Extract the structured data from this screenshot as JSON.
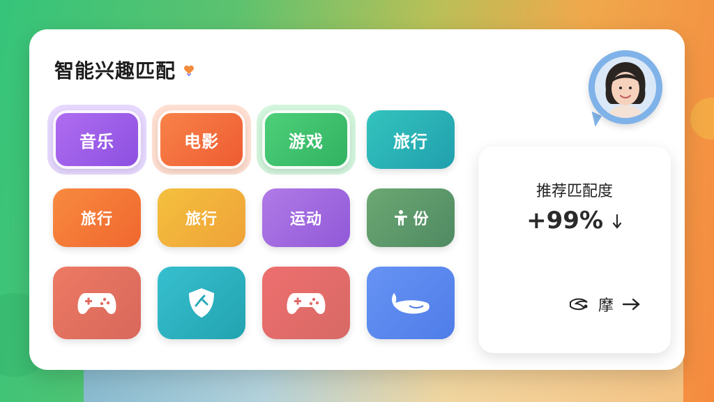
{
  "header": {
    "title": "智能兴趣匹配"
  },
  "tiles": [
    {
      "label": "音乐",
      "color": "#9b5de5",
      "selected": true
    },
    {
      "label": "电影",
      "color": "#f3693d",
      "selected": true
    },
    {
      "label": "游戏",
      "color": "#3cc46a",
      "selected": true
    },
    {
      "label": "旅行",
      "color": "#2fb9b6",
      "selected": false
    },
    {
      "label": "旅行",
      "color": "#f47a35",
      "selected": false
    },
    {
      "label": "旅行",
      "color": "#f0b43a",
      "selected": false
    },
    {
      "label": "运动",
      "color": "#a169e0",
      "selected": false
    },
    {
      "label": "份",
      "color": "#5f9a6a",
      "icon": "fitness-icon",
      "selected": false
    },
    {
      "icon": "gamepad-icon",
      "color": "#e87162"
    },
    {
      "icon": "leaf-badge-icon",
      "color": "#2fb5c3"
    },
    {
      "icon": "gamepad-icon",
      "color": "#e96f6f"
    },
    {
      "icon": "whale-icon",
      "color": "#5b88f0"
    }
  ],
  "match": {
    "label": "推荐匹配度",
    "value": "+99%",
    "action_label": "摩"
  },
  "colors": {
    "accent_green": "#35c47a",
    "accent_orange": "#f58a3f"
  }
}
